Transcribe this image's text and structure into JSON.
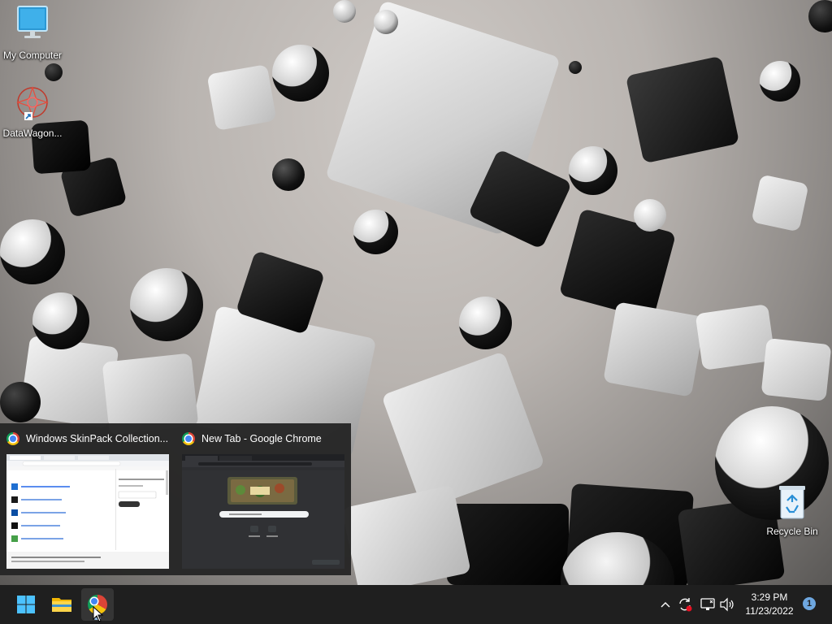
{
  "desktop": {
    "icons": [
      {
        "label": "My Computer",
        "icon": "monitor-icon"
      },
      {
        "label": "DataWagon...",
        "icon": "datawagon-icon"
      },
      {
        "label": "Recycle Bin",
        "icon": "recycle-bin-icon"
      }
    ],
    "wallpaper": "black-white-cubes-and-spheres"
  },
  "previews": [
    {
      "title": "Windows SkinPack Collection...",
      "icon": "chrome-icon"
    },
    {
      "title": "New Tab - Google Chrome",
      "icon": "chrome-icon"
    }
  ],
  "taskbar": {
    "start_icon": "windows-start-icon",
    "pinned": [
      {
        "name": "File Explorer",
        "icon": "folder-icon"
      },
      {
        "name": "Google Chrome",
        "icon": "chrome-icon",
        "active": true
      }
    ],
    "tray": {
      "icons": [
        "chevron-up-icon",
        "sync-icon",
        "network-icon",
        "volume-icon"
      ],
      "time": "3:29 PM",
      "date": "11/23/2022",
      "notification_count": "1"
    }
  },
  "colors": {
    "taskbar": "#1f1f1f",
    "preview_panel": "#262626",
    "accent": "#6ea7e0"
  }
}
